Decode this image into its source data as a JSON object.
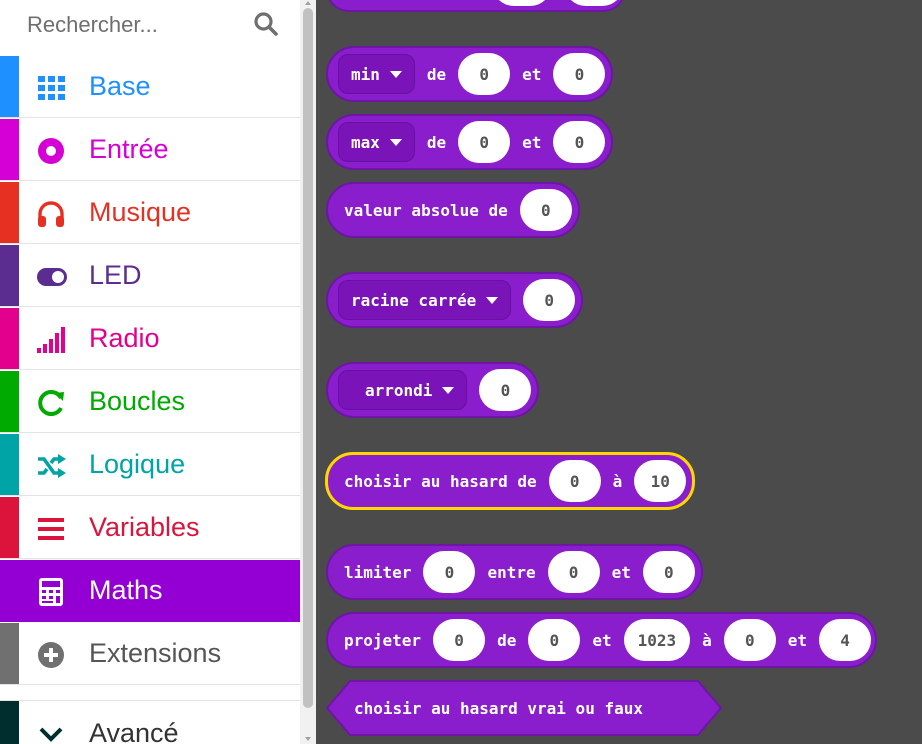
{
  "search": {
    "placeholder": "Rechercher..."
  },
  "categories": [
    {
      "label": "Base",
      "color": "#1e90ff",
      "icon": "grid-icon"
    },
    {
      "label": "Entrée",
      "color": "#d400d4",
      "icon": "radio-button-icon"
    },
    {
      "label": "Musique",
      "color": "#e63022",
      "icon": "headphones-icon"
    },
    {
      "label": "LED",
      "color": "#5c2d91",
      "icon": "toggle-icon"
    },
    {
      "label": "Radio",
      "color": "#e3008c",
      "icon": "signal-bars-icon"
    },
    {
      "label": "Boucles",
      "color": "#00aa00",
      "icon": "refresh-icon"
    },
    {
      "label": "Logique",
      "color": "#00a4a6",
      "icon": "shuffle-icon"
    },
    {
      "label": "Variables",
      "color": "#dc143c",
      "icon": "list-icon"
    },
    {
      "label": "Maths",
      "color": "#9400d3",
      "icon": "calculator-icon",
      "selected": true
    },
    {
      "label": "Extensions",
      "color": "#707070",
      "icon": "plus-circle-icon"
    },
    {
      "label": "Avancé",
      "color": "#002d2d",
      "icon": "chevron-down-icon"
    }
  ],
  "blocks": {
    "top_partial": {
      "values": [
        "",
        ""
      ]
    },
    "min": {
      "op": "min",
      "de": "de",
      "a": "0",
      "et": "et",
      "b": "0"
    },
    "max": {
      "op": "max",
      "de": "de",
      "a": "0",
      "et": "et",
      "b": "0"
    },
    "abs": {
      "label": "valeur absolue de",
      "value": "0"
    },
    "sqrt": {
      "op": "racine carrée",
      "value": "0"
    },
    "round": {
      "op": "arrondi",
      "value": "0"
    },
    "random": {
      "label": "choisir au hasard de",
      "from": "0",
      "a_label": "à",
      "to": "10"
    },
    "constrain": {
      "label": "limiter",
      "value": "0",
      "between": "entre",
      "low": "0",
      "et": "et",
      "high": "0"
    },
    "map": {
      "label": "projeter",
      "value": "0",
      "de": "de",
      "from_low": "0",
      "et1": "et",
      "from_high": "1023",
      "a_label": "à",
      "to_low": "0",
      "et2": "et",
      "to_high": "4"
    },
    "random_bool": {
      "label": "choisir au hasard vrai ou faux"
    }
  },
  "colors": {
    "maths_block": "#8a1ecc",
    "selection_outline": "#ffd700",
    "workspace_bg": "#4b4b4b"
  }
}
